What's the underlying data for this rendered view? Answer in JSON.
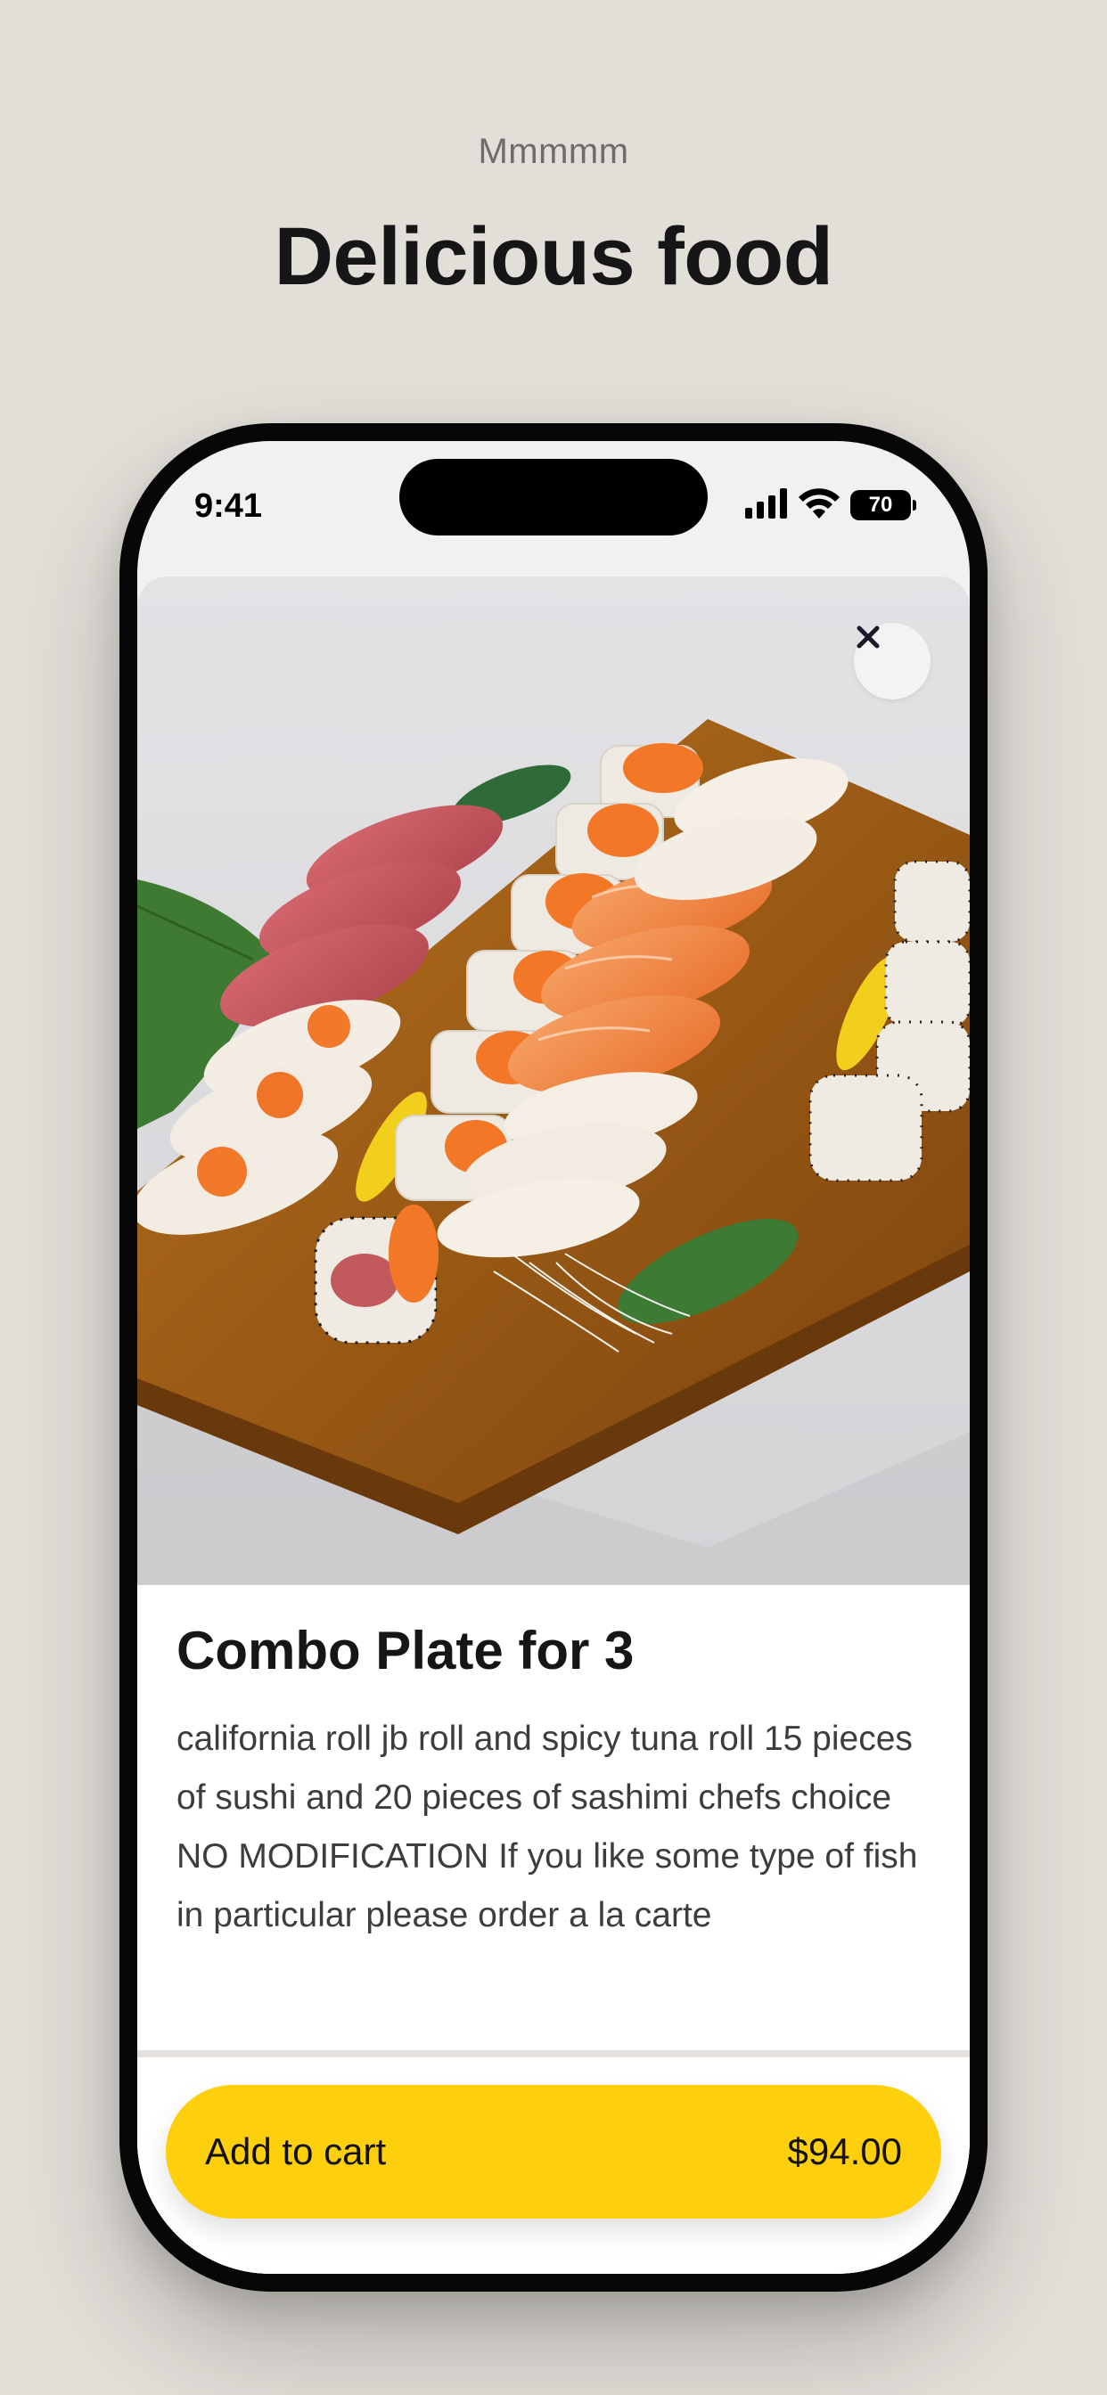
{
  "header": {
    "eyebrow": "Mmmmm",
    "title": "Delicious food"
  },
  "status_bar": {
    "time": "9:41",
    "battery": "70"
  },
  "item": {
    "name": "Combo Plate for 3",
    "description": "california roll jb roll and spicy tuna roll 15 pieces of sushi and 20 pieces of sashimi chefs choice NO MODIFICATION If you like some type of fish in particular please order a la carte",
    "price": "$94.00"
  },
  "actions": {
    "add_to_cart_label": "Add to cart",
    "close_icon": "close-icon"
  },
  "colors": {
    "background": "#e2dfd9",
    "accent": "#fecf0c",
    "text": "#161616"
  }
}
